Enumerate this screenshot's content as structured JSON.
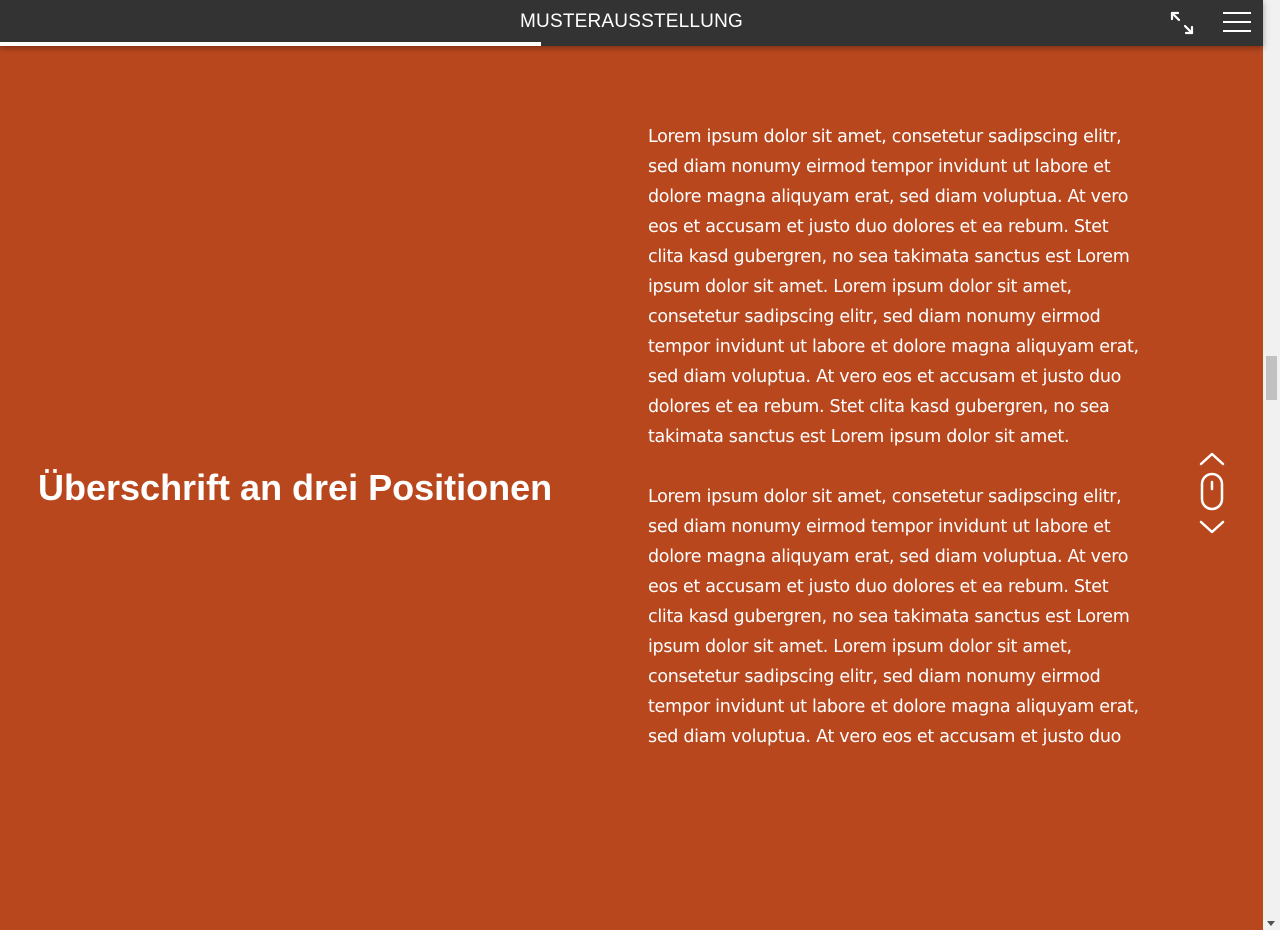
{
  "header": {
    "title": "MUSTERAUSSTELLUNG",
    "progress": 0.428,
    "fullscreen_icon": "fullscreen-expand-icon",
    "menu_icon": "hamburger-menu-icon"
  },
  "main": {
    "heading": "Überschrift an drei Positionen",
    "paragraphs": [
      "Lorem ipsum dolor sit amet, consetetur sadipscing elitr, sed diam nonumy eirmod tempor invidunt ut labore et dolore magna aliquyam erat, sed diam voluptua. At vero eos et accusam et justo duo dolores et ea rebum. Stet clita kasd gubergren, no sea takimata sanctus est Lorem ipsum dolor sit amet. Lorem ipsum dolor sit amet, consetetur sadipscing elitr, sed diam nonumy eirmod tempor invidunt ut labore et dolore magna aliquyam erat, sed diam voluptua. At vero eos et accusam et justo duo dolores et ea rebum. Stet clita kasd gubergren, no sea takimata sanctus est Lorem ipsum dolor sit amet.",
      "Lorem ipsum dolor sit amet, consetetur sadipscing elitr, sed diam nonumy eirmod tempor invidunt ut labore et dolore magna aliquyam erat, sed diam voluptua. At vero eos et accusam et justo duo dolores et ea rebum. Stet clita kasd gubergren, no sea takimata sanctus est Lorem ipsum dolor sit amet. Lorem ipsum dolor sit amet, consetetur sadipscing elitr, sed diam nonumy eirmod tempor invidunt ut labore et dolore magna aliquyam erat, sed diam voluptua. At vero eos et accusam et justo duo"
    ]
  },
  "scroll_nav": {
    "up_icon": "chevron-up-icon",
    "mouse_icon": "mouse-icon",
    "down_icon": "chevron-down-icon"
  },
  "colors": {
    "background": "#b8471e",
    "header_bg": "#333333",
    "text": "#ffffff",
    "progress": "#ffffff"
  }
}
